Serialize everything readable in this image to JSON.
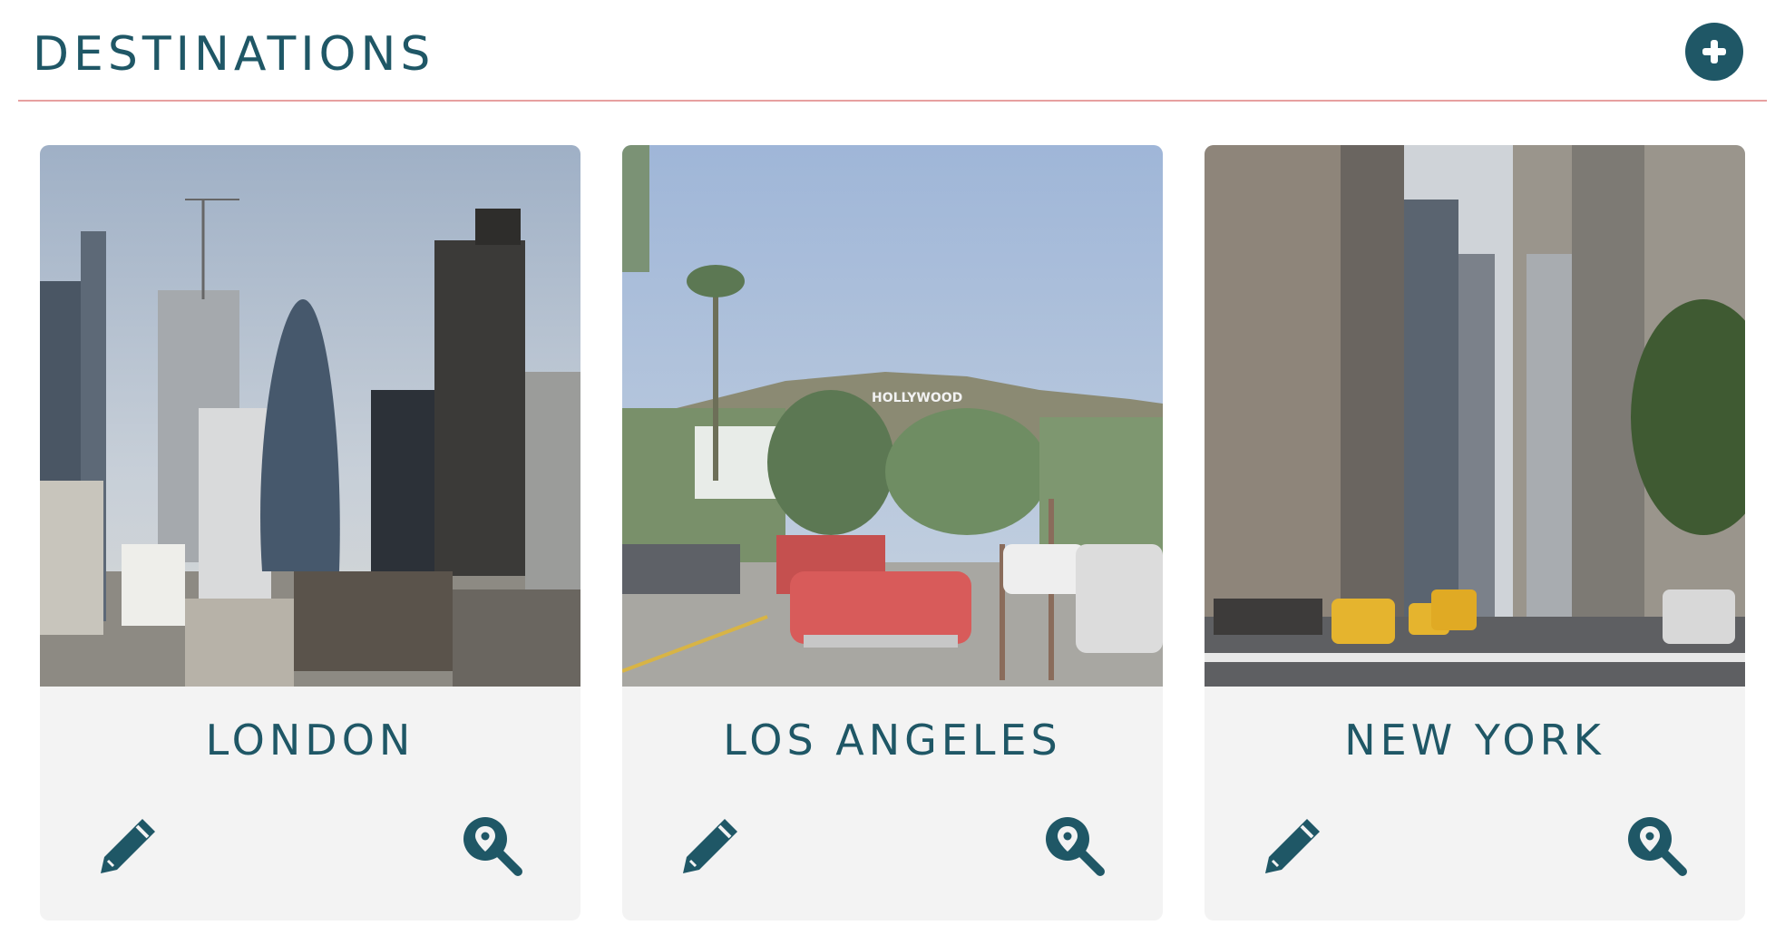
{
  "header": {
    "title": "DESTINATIONS",
    "add_icon": "plus-icon"
  },
  "colors": {
    "accent": "#1f5766",
    "divider": "#e7a0a0",
    "card_background": "#f3f3f3"
  },
  "destinations": [
    {
      "name": "LONDON",
      "image": "london-skyline-photo",
      "edit_icon": "pencil-icon",
      "view_icon": "map-search-icon"
    },
    {
      "name": "LOS ANGELES",
      "image": "los-angeles-hollywood-photo",
      "edit_icon": "pencil-icon",
      "view_icon": "map-search-icon"
    },
    {
      "name": "NEW YORK",
      "image": "new-york-street-photo",
      "edit_icon": "pencil-icon",
      "view_icon": "map-search-icon"
    }
  ]
}
